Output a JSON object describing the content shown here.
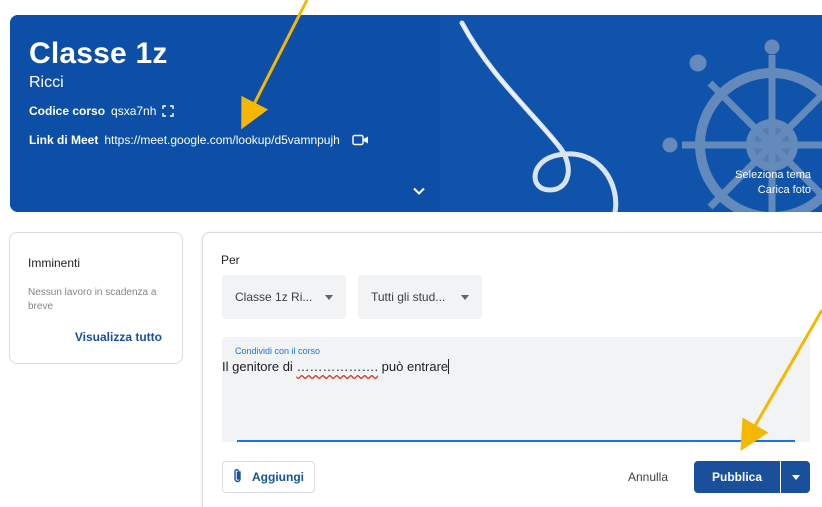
{
  "banner": {
    "title": "Classe 1z",
    "section": "Ricci",
    "course_code_label": "Codice corso",
    "course_code": "qsxa7nh",
    "meet_label": "Link di Meet",
    "meet_url": "https://meet.google.com/lookup/d5vamnpujh",
    "select_theme": "Seleziona tema",
    "upload_photo": "Carica foto",
    "color": "#0d4fa6"
  },
  "upcoming": {
    "title": "Imminenti",
    "empty_text": "Nessun lavoro in scadenza a breve",
    "view_all": "Visualizza tutto"
  },
  "composer": {
    "for_label": "Per",
    "class_select": "Classe 1z Ri...",
    "students_select": "Tutti gli stud...",
    "share_label": "Condividi con il corso",
    "text_before": "Il genitore di ",
    "text_blank": "……………….",
    "text_after": " può entrare",
    "add_label": "Aggiungi",
    "cancel_label": "Annulla",
    "publish_label": "Pubblica",
    "accent": "#1a73e8",
    "publish_color": "#1a4f9c"
  },
  "annotation": {
    "arrow_color": "#f5b800"
  },
  "icons": {
    "code_expand": "fullscreen-icon",
    "meet": "video-camera-icon",
    "expand": "chevron-down-icon",
    "attach": "paperclip-icon",
    "publish_menu": "caret-down-icon"
  }
}
